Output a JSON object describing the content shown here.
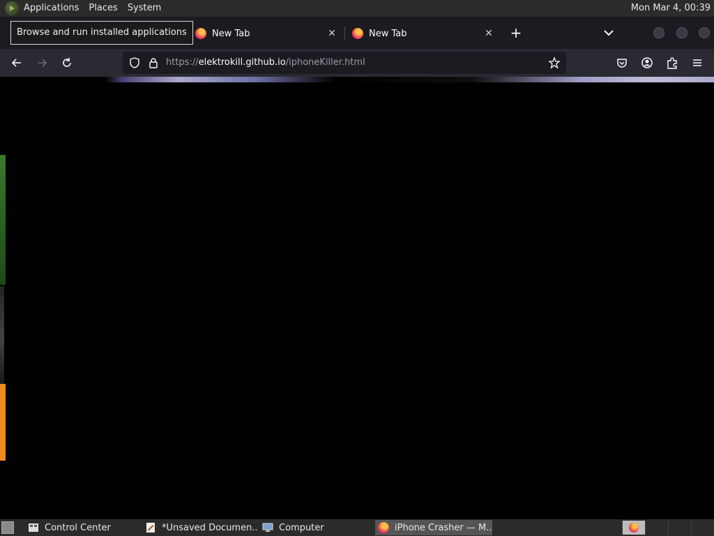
{
  "top_panel": {
    "menus": [
      "Applications",
      "Places",
      "System"
    ],
    "clock": "Mon Mar  4, 00:39"
  },
  "tooltip": "Browse and run installed applications",
  "tabs": [
    {
      "label": "New Tab"
    },
    {
      "label": "New Tab"
    }
  ],
  "url": {
    "scheme": "https://",
    "host": "elektrokill.github.io",
    "path": "/iphoneKiller.html"
  },
  "taskbar": {
    "items": [
      {
        "label": "Control Center",
        "icon": "control-center-icon"
      },
      {
        "label": "*Unsaved Documen...",
        "icon": "text-editor-icon"
      },
      {
        "label": "Computer",
        "icon": "computer-icon"
      },
      {
        "label": "iPhone Crasher — M...",
        "icon": "firefox-icon"
      }
    ]
  },
  "colors": {
    "panel": "#2b2b2b",
    "tabbar": "#1c1b22",
    "navbar": "#2b2a33",
    "content": "#000000",
    "orange_accent": "#f08a1c",
    "green_accent": "#3a7a2a"
  }
}
